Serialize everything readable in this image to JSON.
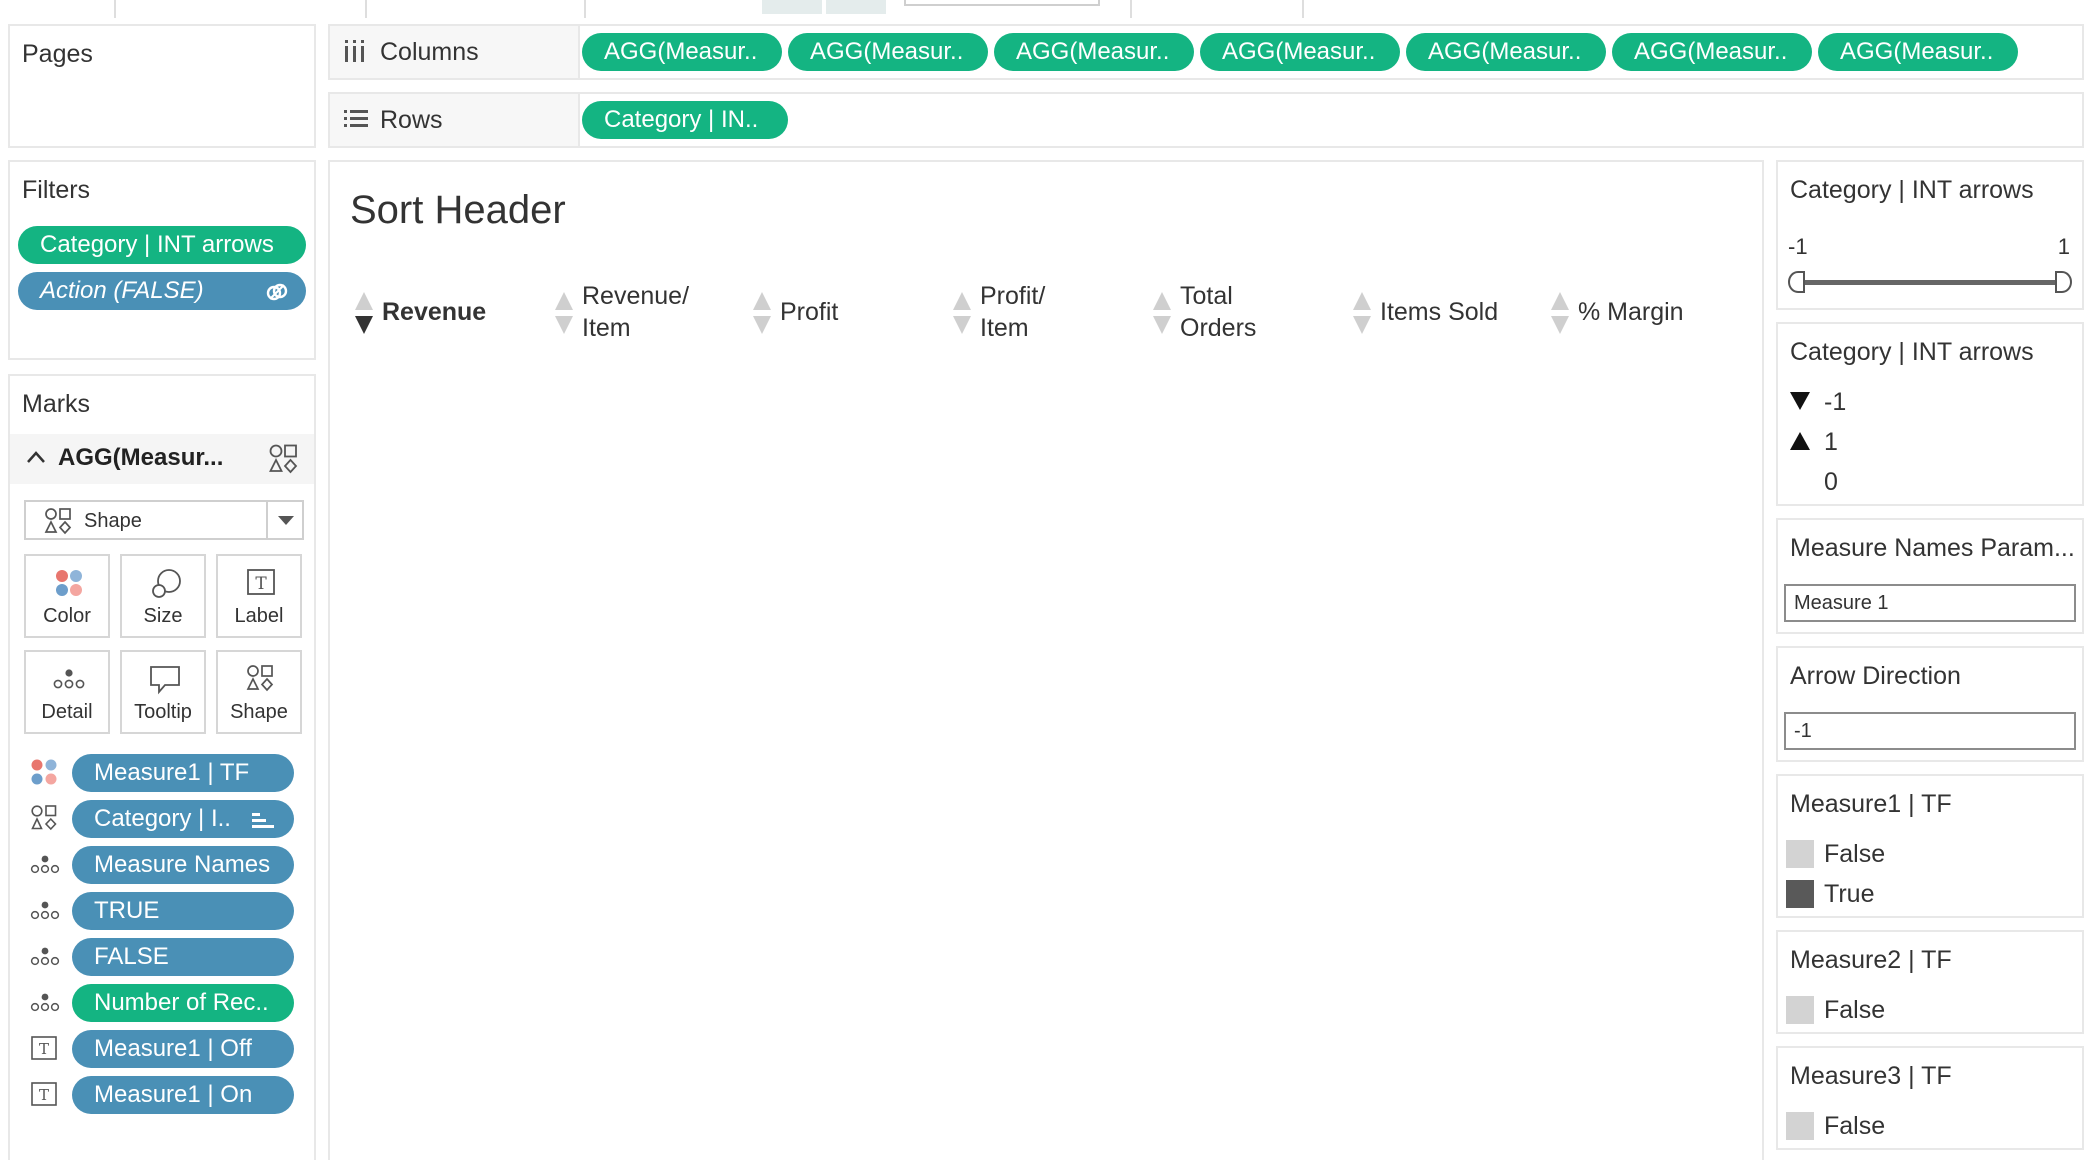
{
  "pages": {
    "title": "Pages"
  },
  "columns": {
    "label": "Columns",
    "pills": [
      "AGG(Measur..",
      "AGG(Measur..",
      "AGG(Measur..",
      "AGG(Measur..",
      "AGG(Measur..",
      "AGG(Measur..",
      "AGG(Measur.."
    ]
  },
  "rows": {
    "label": "Rows",
    "pills": [
      "Category | IN.."
    ]
  },
  "filters": {
    "title": "Filters",
    "items": [
      {
        "label": "Category | INT arrows",
        "color": "#14b482"
      },
      {
        "label": "Action (FALSE)",
        "color": "#4a90b6"
      }
    ]
  },
  "marks": {
    "title": "Marks",
    "card_name": "AGG(Measur...",
    "mark_type": "Shape",
    "buttons": [
      "Color",
      "Size",
      "Label",
      "Detail",
      "Tooltip",
      "Shape"
    ],
    "fields": [
      {
        "icon": "color-icon",
        "label": "Measure1 | TF",
        "color": "#4a90b6"
      },
      {
        "icon": "shape-icon",
        "label": "Category | I..",
        "color": "#4a90b6"
      },
      {
        "icon": "detail-icon",
        "label": "Measure Names",
        "color": "#4a90b6"
      },
      {
        "icon": "detail-icon",
        "label": "TRUE",
        "color": "#4a90b6"
      },
      {
        "icon": "detail-icon",
        "label": "FALSE",
        "color": "#4a90b6"
      },
      {
        "icon": "detail-icon",
        "label": "Number of Rec..",
        "color": "#14b482"
      },
      {
        "icon": "label-icon",
        "label": "Measure1 | Off",
        "color": "#4a90b6"
      },
      {
        "icon": "label-icon",
        "label": "Measure1 | On",
        "color": "#4a90b6"
      }
    ]
  },
  "view": {
    "title": "Sort Header",
    "headers": [
      {
        "label": "Revenue",
        "bold": true,
        "active": true
      },
      {
        "label": "Revenue/\nItem"
      },
      {
        "label": "Profit"
      },
      {
        "label": "Profit/\nItem"
      },
      {
        "label": "Total\nOrders"
      },
      {
        "label": "Items Sold"
      },
      {
        "label": "% Margin"
      }
    ]
  },
  "slider": {
    "title": "Category | INT arrows",
    "min": "-1",
    "max": "1"
  },
  "shape_legend": {
    "title": "Category | INT arrows",
    "items": [
      {
        "shape": "triangle-down-icon",
        "label": "-1"
      },
      {
        "shape": "triangle-up-icon",
        "label": "1"
      },
      {
        "shape": "none",
        "label": "0"
      }
    ]
  },
  "measure_param": {
    "title": "Measure Names Param...",
    "value": "Measure 1"
  },
  "arrow_direction": {
    "title": "Arrow Direction",
    "value": "-1"
  },
  "legend1": {
    "title": "Measure1 | TF",
    "items": [
      {
        "label": "False",
        "color": "#d3d3d3"
      },
      {
        "label": "True",
        "color": "#595959"
      }
    ]
  },
  "legend2": {
    "title": "Measure2 | TF",
    "items": [
      {
        "label": "False",
        "color": "#d3d3d3"
      }
    ]
  },
  "legend3": {
    "title": "Measure3 | TF",
    "items": [
      {
        "label": "False",
        "color": "#d3d3d3"
      }
    ]
  }
}
